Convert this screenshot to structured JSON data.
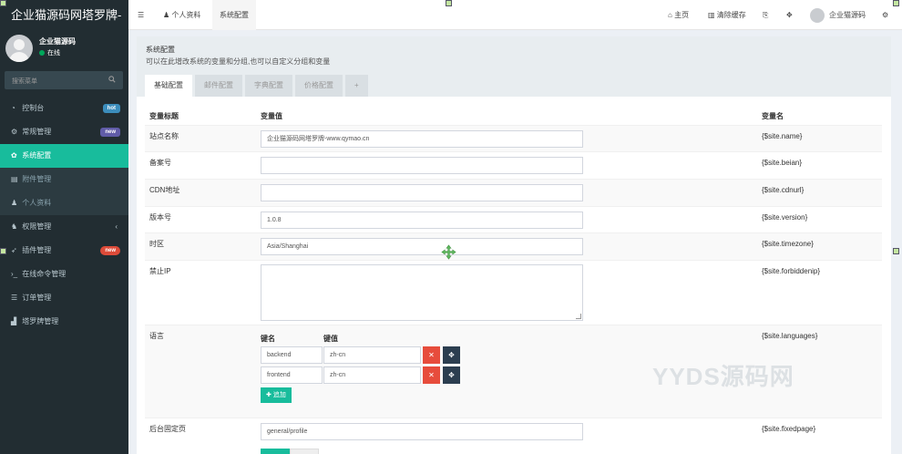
{
  "brand": "企业猫源码网塔罗牌-",
  "user": {
    "name": "企业猫源码",
    "status": "在线"
  },
  "search": {
    "placeholder": "搜索菜单"
  },
  "menu": [
    {
      "label": "控制台",
      "icon": "dashboard-icon",
      "badge": "hot"
    },
    {
      "label": "常规管理",
      "icon": "cogs-icon",
      "badge": "new"
    },
    {
      "label": "系统配置",
      "icon": "gear-icon"
    },
    {
      "label": "附件管理",
      "icon": "file-icon"
    },
    {
      "label": "个人资料",
      "icon": "user-icon"
    },
    {
      "label": "权限管理",
      "icon": "group-icon"
    },
    {
      "label": "插件管理",
      "icon": "rocket-icon",
      "badge": "new"
    },
    {
      "label": "在线命令管理",
      "icon": "terminal-icon"
    },
    {
      "label": "订单管理",
      "icon": "list-icon"
    },
    {
      "label": "塔罗牌管理",
      "icon": "chart-icon"
    }
  ],
  "topbar": {
    "tabs": [
      "个人资料",
      "系统配置"
    ],
    "home": "主页",
    "clear_cache": "清除缓存",
    "username": "企业猫源码"
  },
  "panel": {
    "title": "系统配置",
    "desc": "可以在此增改系统的变量和分组,也可以自定义分组和变量",
    "tabs": [
      "基础配置",
      "邮件配置",
      "字典配置",
      "价格配置",
      "+"
    ]
  },
  "table": {
    "headers": [
      "变量标题",
      "变量值",
      "变量名"
    ],
    "rows": [
      {
        "title": "站点名称",
        "value": "企业猫源码网塔罗牌-www.qymao.cn",
        "var": "{$site.name}"
      },
      {
        "title": "备案号",
        "value": "",
        "var": "{$site.beian}"
      },
      {
        "title": "CDN地址",
        "value": "",
        "var": "{$site.cdnurl}"
      },
      {
        "title": "版本号",
        "value": "1.0.8",
        "var": "{$site.version}"
      },
      {
        "title": "时区",
        "value": "Asia/Shanghai",
        "var": "{$site.timezone}"
      },
      {
        "title": "禁止IP",
        "value": "",
        "var": "{$site.forbiddenip}"
      },
      {
        "title": "语言",
        "var": "{$site.languages}"
      },
      {
        "title": "后台固定页",
        "value": "general/profile",
        "var": "{$site.fixedpage}"
      }
    ],
    "languages": {
      "key_header": "键名",
      "value_header": "键值",
      "pairs": [
        {
          "key": "backend",
          "value": "zh-cn"
        },
        {
          "key": "frontend",
          "value": "zh-cn"
        }
      ],
      "add_label": "追加"
    }
  },
  "watermark": "YYDS源码网"
}
